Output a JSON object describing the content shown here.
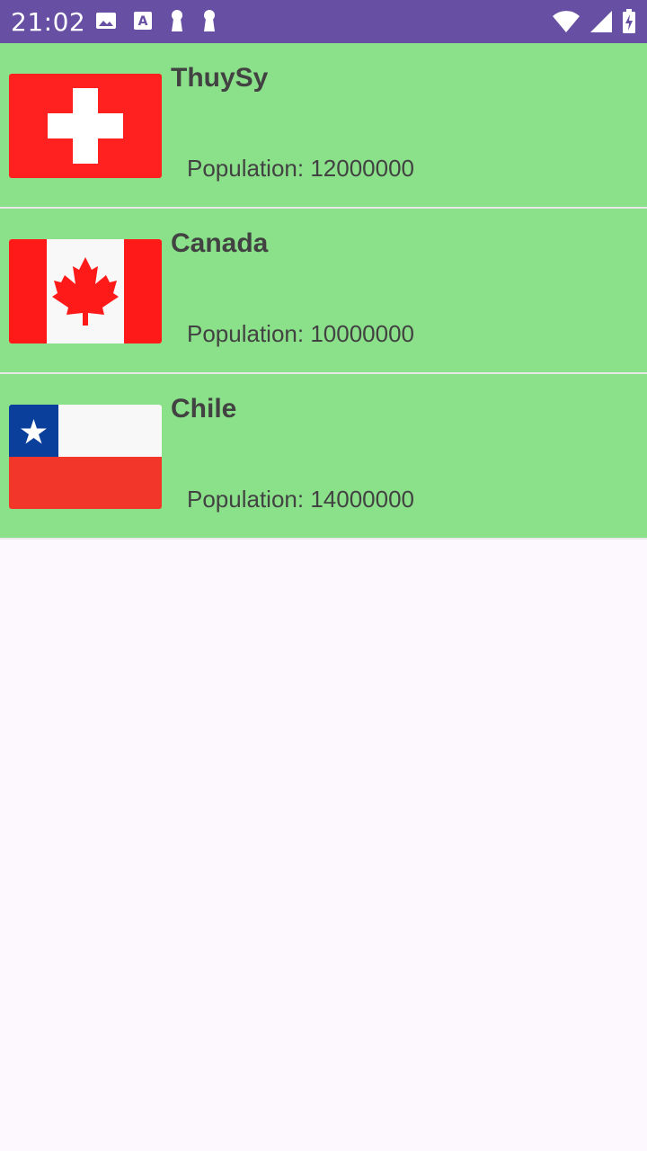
{
  "status_bar": {
    "time": "21:02",
    "left_icons": [
      "image-icon",
      "text-a-icon",
      "keyhole-icon",
      "keyhole-icon"
    ],
    "right_icons": [
      "wifi-icon",
      "signal-icon",
      "battery-charging-icon"
    ],
    "background": "#6750a4"
  },
  "countries": [
    {
      "name": "ThuySy",
      "population_text": "Population: 12000000",
      "flag": "switzerland-flag-icon"
    },
    {
      "name": "Canada",
      "population_text": "Population: 10000000",
      "flag": "canada-flag-icon"
    },
    {
      "name": "Chile",
      "population_text": "Population: 14000000",
      "flag": "chile-flag-icon"
    }
  ],
  "colors": {
    "row_background": "#8be08a",
    "text": "#424242",
    "page_background": "#fdf8fd"
  }
}
